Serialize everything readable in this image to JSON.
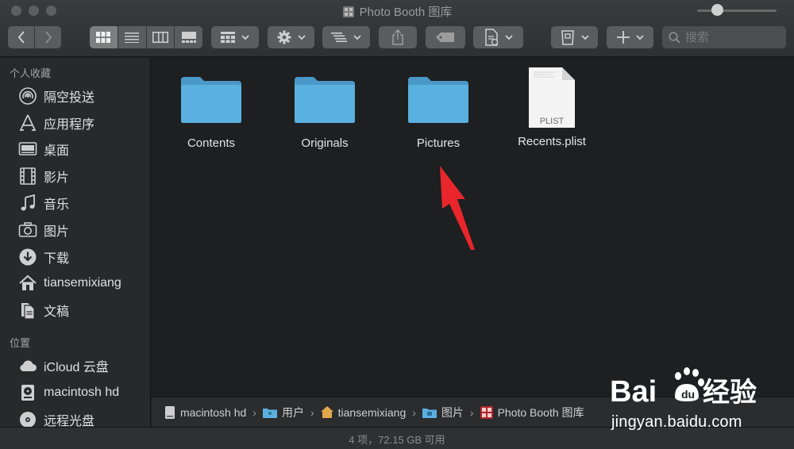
{
  "window": {
    "title": "Photo Booth 图库"
  },
  "toolbar": {
    "search_placeholder": "搜索"
  },
  "sidebar": {
    "favorites_title": "个人收藏",
    "favorites": [
      {
        "label": "隔空投送",
        "icon": "airdrop-icon"
      },
      {
        "label": "应用程序",
        "icon": "applications-icon"
      },
      {
        "label": "桌面",
        "icon": "desktop-icon"
      },
      {
        "label": "影片",
        "icon": "movies-icon"
      },
      {
        "label": "音乐",
        "icon": "music-icon"
      },
      {
        "label": "图片",
        "icon": "pictures-icon"
      },
      {
        "label": "下载",
        "icon": "downloads-icon"
      },
      {
        "label": "tiansemixiang",
        "icon": "home-icon"
      },
      {
        "label": "文稿",
        "icon": "documents-icon"
      }
    ],
    "locations_title": "位置",
    "locations": [
      {
        "label": "iCloud 云盘",
        "icon": "icloud-icon"
      },
      {
        "label": "macintosh hd",
        "icon": "hard-drive-icon"
      },
      {
        "label": "远程光盘",
        "icon": "disc-icon"
      }
    ]
  },
  "files": [
    {
      "name": "Contents",
      "kind": "folder"
    },
    {
      "name": "Originals",
      "kind": "folder"
    },
    {
      "name": "Pictures",
      "kind": "folder"
    },
    {
      "name": "Recents.plist",
      "kind": "plist",
      "badge": "PLIST"
    }
  ],
  "pathbar": {
    "crumbs": [
      "macintosh hd",
      "用户",
      "tiansemixiang",
      "图片",
      "Photo Booth 图库"
    ]
  },
  "status": {
    "text": "4 项，72.15 GB 可用",
    "zoom_fraction": 0.25
  },
  "watermark": {
    "url": "jingyan.baidu.com"
  },
  "colors": {
    "folder": "#5ab0de",
    "accent_arrow": "#e8262b"
  }
}
